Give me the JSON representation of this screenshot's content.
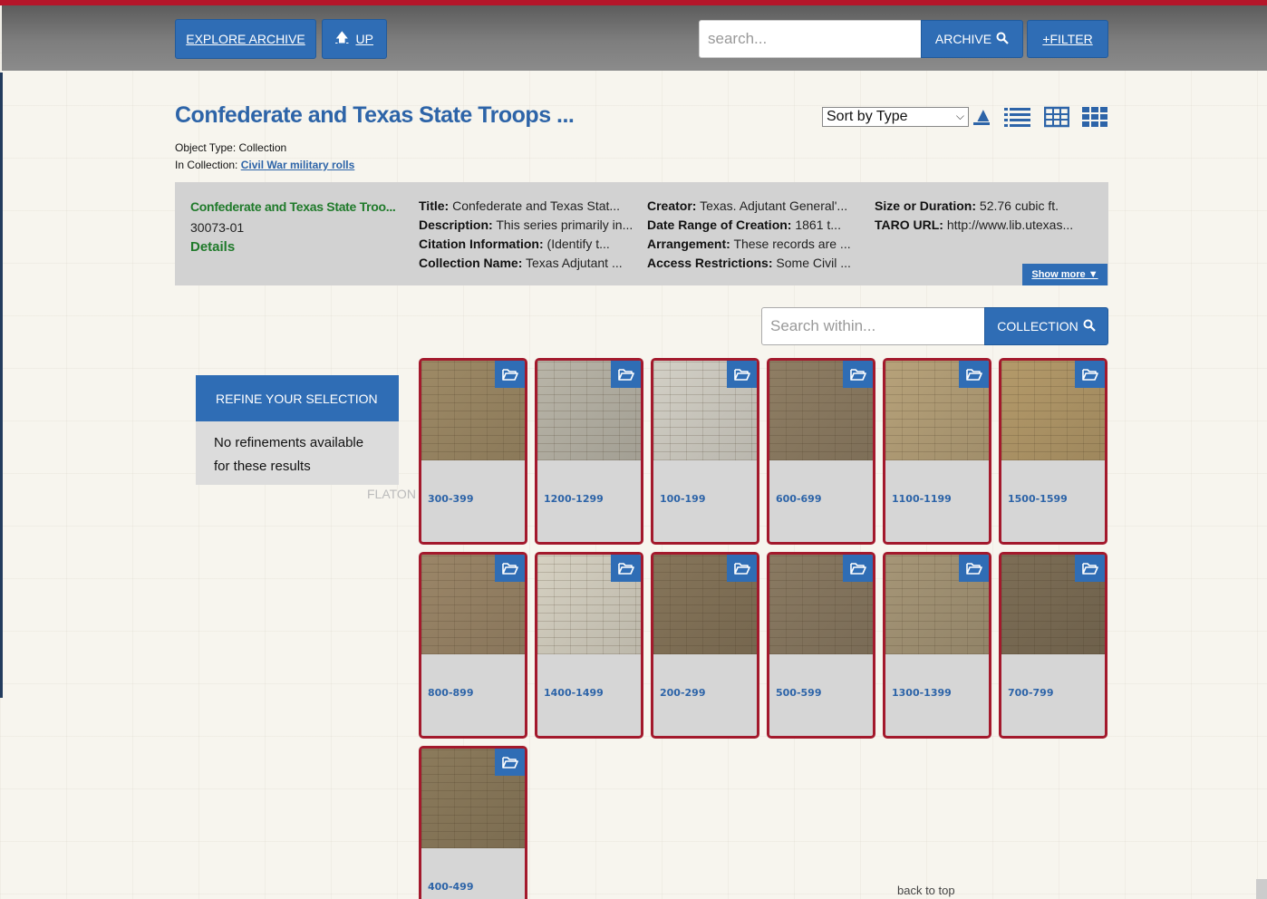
{
  "nav": {
    "explore_label": "EXPLORE ARCHIVE",
    "up_label": "UP",
    "search_placeholder": "search...",
    "archive_label": "ARCHIVE",
    "filter_label": "+FILTER"
  },
  "header": {
    "title": "Confederate and Texas State Troops ...",
    "object_type_label": "Object Type:",
    "object_type": "Collection",
    "in_collection_label": "In Collection:",
    "collection_link": "Civil War military rolls"
  },
  "sort": {
    "selected": "Sort by Type"
  },
  "info": {
    "title": "Confederate and Texas State Troo...",
    "id": "30073-01",
    "details_label": "Details",
    "rows": [
      {
        "k1": "Title:",
        "v1": "Confederate and Texas Stat...",
        "k2": "Creator:",
        "v2": "Texas. Adjutant General'...",
        "k3": "Size or Duration:",
        "v3": "52.76 cubic ft."
      },
      {
        "k1": "Description:",
        "v1": "This series primarily in...",
        "k2": "Date Range of Creation:",
        "v2": "1861 t...",
        "k3": "TARO URL:",
        "v3": "http://www.lib.utexas..."
      },
      {
        "k1": "Citation Information:",
        "v1": "(Identify t...",
        "k2": "Arrangement:",
        "v2": "These records are ...",
        "k3": "",
        "v3": ""
      },
      {
        "k1": "Collection Name:",
        "v1": "Texas Adjutant ...",
        "k2": "Access Restrictions:",
        "v2": "Some Civil ...",
        "k3": "",
        "v3": ""
      }
    ],
    "show_more_label": "Show more ▼"
  },
  "search_within": {
    "placeholder": "Search within...",
    "button_label": "COLLECTION"
  },
  "refine": {
    "heading": "REFINE YOUR SELECTION",
    "body": "No refinements available for these results"
  },
  "cards": [
    {
      "label": "300-399",
      "tone": "#9e8a66"
    },
    {
      "label": "1200-1299",
      "tone": "#b9b5a8"
    },
    {
      "label": "100-199",
      "tone": "#d3d0c6"
    },
    {
      "label": "600-699",
      "tone": "#8f7e64"
    },
    {
      "label": "1100-1199",
      "tone": "#b7a27a"
    },
    {
      "label": "1500-1599",
      "tone": "#b49a6a"
    },
    {
      "label": "800-899",
      "tone": "#9b8668"
    },
    {
      "label": "1400-1499",
      "tone": "#d6d1c2"
    },
    {
      "label": "200-299",
      "tone": "#86755a"
    },
    {
      "label": "500-599",
      "tone": "#8a7a62"
    },
    {
      "label": "1300-1399",
      "tone": "#a69677"
    },
    {
      "label": "700-799",
      "tone": "#7d6e56"
    },
    {
      "label": "400-499",
      "tone": "#8c7b5c"
    }
  ],
  "footer": {
    "back_to_top": "back to top"
  },
  "colors": {
    "brand_blue": "#2f6db5",
    "card_border": "#a3192c",
    "details_green": "#1f7a2a"
  }
}
